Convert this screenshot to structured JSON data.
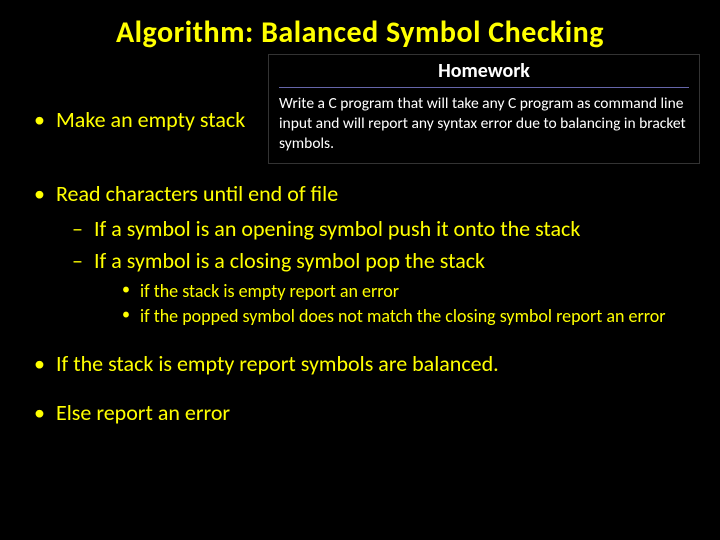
{
  "title": "Algorithm: Balanced Symbol Checking",
  "homework": {
    "title": "Homework",
    "body": "Write a C program that will take any C program as command line input and will report any syntax error due to balancing in bracket symbols."
  },
  "bullets": {
    "b1": "Make an empty stack",
    "b2": "Read characters until end of file",
    "b2_s1": "If a symbol is an opening symbol push it onto the stack",
    "b2_s2": "If a symbol is a closing symbol pop the stack",
    "b2_s2_a": "if the stack is empty report an error",
    "b2_s2_b": "if the popped symbol does not match the closing symbol report an error",
    "b3": "If the stack is empty report symbols are balanced.",
    "b4": "Else report an error"
  }
}
